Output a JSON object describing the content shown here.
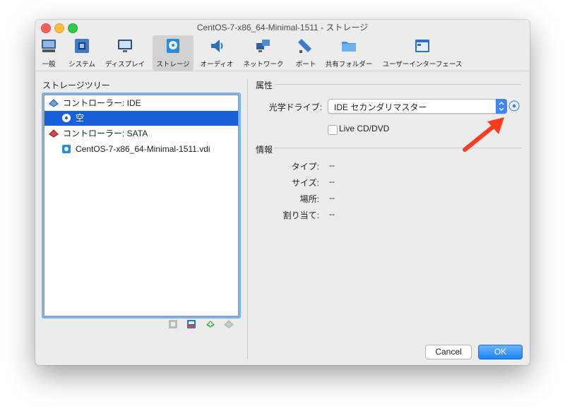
{
  "window": {
    "title": "CentOS-7-x86_64-Minimal-1511 - ストレージ"
  },
  "toolbar": {
    "items": [
      {
        "label": "一般",
        "icon": "general-icon"
      },
      {
        "label": "システム",
        "icon": "system-icon"
      },
      {
        "label": "ディスプレイ",
        "icon": "display-icon"
      },
      {
        "label": "ストレージ",
        "icon": "storage-icon",
        "active": true
      },
      {
        "label": "オーディオ",
        "icon": "audio-icon"
      },
      {
        "label": "ネットワーク",
        "icon": "network-icon"
      },
      {
        "label": "ポート",
        "icon": "ports-icon"
      },
      {
        "label": "共有フォルダー",
        "icon": "shared-folder-icon"
      },
      {
        "label": "ユーザーインターフェース",
        "icon": "user-interface-icon"
      }
    ]
  },
  "storage_tree": {
    "title": "ストレージツリー",
    "rows": [
      {
        "label": "コントローラー: IDE",
        "icon": "ide-controller-icon"
      },
      {
        "label": "空",
        "icon": "optical-disc-icon",
        "selected": true
      },
      {
        "label": "コントローラー: SATA",
        "icon": "sata-controller-icon"
      },
      {
        "label": "CentOS-7-x86_64-Minimal-1511.vdi",
        "icon": "hard-disk-icon"
      }
    ],
    "buttons": [
      "remove-controller-icon",
      "add-hard-disk-icon",
      "add-attachment-icon",
      "remove-attachment-icon"
    ]
  },
  "attributes": {
    "title": "属性",
    "optical_drive_label": "光学ドライブ:",
    "optical_drive_value": "IDE セカンダリマスター",
    "live_cd_label": "Live CD/DVD",
    "live_cd_checked": false
  },
  "info": {
    "title": "情報",
    "rows": [
      {
        "label": "タイプ:",
        "value": "--"
      },
      {
        "label": "サイズ:",
        "value": "--"
      },
      {
        "label": "場所:",
        "value": "--"
      },
      {
        "label": "割り当て:",
        "value": "--"
      }
    ]
  },
  "footer": {
    "cancel": "Cancel",
    "ok": "OK"
  },
  "colors": {
    "selection": "#1760d8",
    "accent": "#1a82fb",
    "arrow": "#ff3b1f"
  }
}
